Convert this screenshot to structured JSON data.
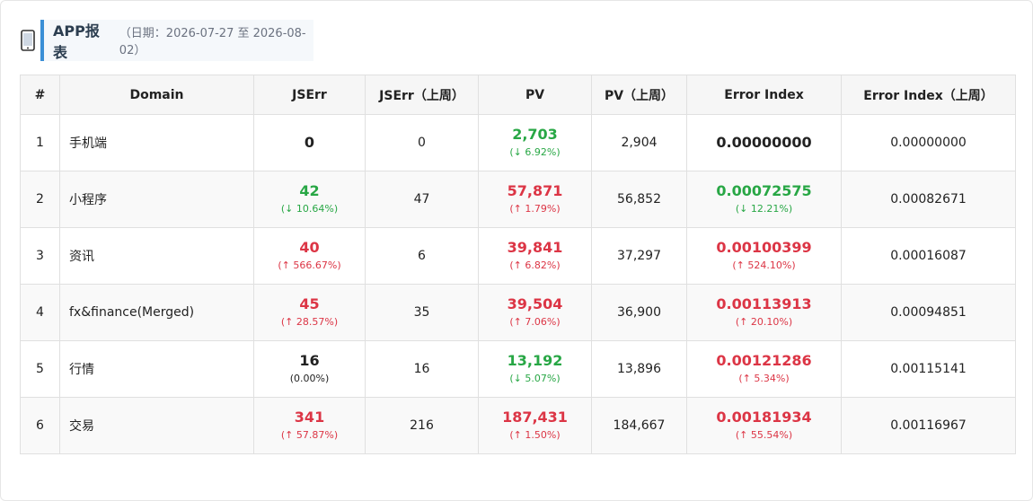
{
  "header": {
    "title": "APP报表",
    "range": "（日期：2026-07-27 至 2026-08-02）"
  },
  "columns": [
    "#",
    "Domain",
    "JSErr",
    "JSErr（上周）",
    "PV",
    "PV（上周）",
    "Error Index",
    "Error Index（上周）"
  ],
  "rows": [
    {
      "idx": "1",
      "domain": "手机端",
      "jserr": "0",
      "jserr_change": "",
      "jserr_tone": "neutral",
      "jserr_prev": "0",
      "pv": "2,703",
      "pv_change": "(↓ 6.92%)",
      "pv_tone": "green",
      "pv_prev": "2,904",
      "ei": "0.00000000",
      "ei_change": "",
      "ei_tone": "neutral",
      "ei_prev": "0.00000000"
    },
    {
      "idx": "2",
      "domain": "小程序",
      "jserr": "42",
      "jserr_change": "(↓ 10.64%)",
      "jserr_tone": "green",
      "jserr_prev": "47",
      "pv": "57,871",
      "pv_change": "(↑ 1.79%)",
      "pv_tone": "red",
      "pv_prev": "56,852",
      "ei": "0.00072575",
      "ei_change": "(↓ 12.21%)",
      "ei_tone": "green",
      "ei_prev": "0.00082671"
    },
    {
      "idx": "3",
      "domain": "资讯",
      "jserr": "40",
      "jserr_change": "(↑ 566.67%)",
      "jserr_tone": "red",
      "jserr_prev": "6",
      "pv": "39,841",
      "pv_change": "(↑ 6.82%)",
      "pv_tone": "red",
      "pv_prev": "37,297",
      "ei": "0.00100399",
      "ei_change": "(↑ 524.10%)",
      "ei_tone": "red",
      "ei_prev": "0.00016087"
    },
    {
      "idx": "4",
      "domain": "fx&finance(Merged)",
      "jserr": "45",
      "jserr_change": "(↑ 28.57%)",
      "jserr_tone": "red",
      "jserr_prev": "35",
      "pv": "39,504",
      "pv_change": "(↑ 7.06%)",
      "pv_tone": "red",
      "pv_prev": "36,900",
      "ei": "0.00113913",
      "ei_change": "(↑ 20.10%)",
      "ei_tone": "red",
      "ei_prev": "0.00094851"
    },
    {
      "idx": "5",
      "domain": "行情",
      "jserr": "16",
      "jserr_change": "(0.00%)",
      "jserr_tone": "neutral",
      "jserr_prev": "16",
      "pv": "13,192",
      "pv_change": "(↓ 5.07%)",
      "pv_tone": "green",
      "pv_prev": "13,896",
      "ei": "0.00121286",
      "ei_change": "(↑ 5.34%)",
      "ei_tone": "red",
      "ei_prev": "0.00115141"
    },
    {
      "idx": "6",
      "domain": "交易",
      "jserr": "341",
      "jserr_change": "(↑ 57.87%)",
      "jserr_tone": "red",
      "jserr_prev": "216",
      "pv": "187,431",
      "pv_change": "(↑ 1.50%)",
      "pv_tone": "red",
      "pv_prev": "184,667",
      "ei": "0.00181934",
      "ei_change": "(↑ 55.54%)",
      "ei_tone": "red",
      "ei_prev": "0.00116967"
    }
  ],
  "colors": {
    "accent": "#3a8fd6",
    "up": "#dc3545",
    "down": "#28a745"
  },
  "icons": {
    "app": "mobile-phone-icon"
  }
}
